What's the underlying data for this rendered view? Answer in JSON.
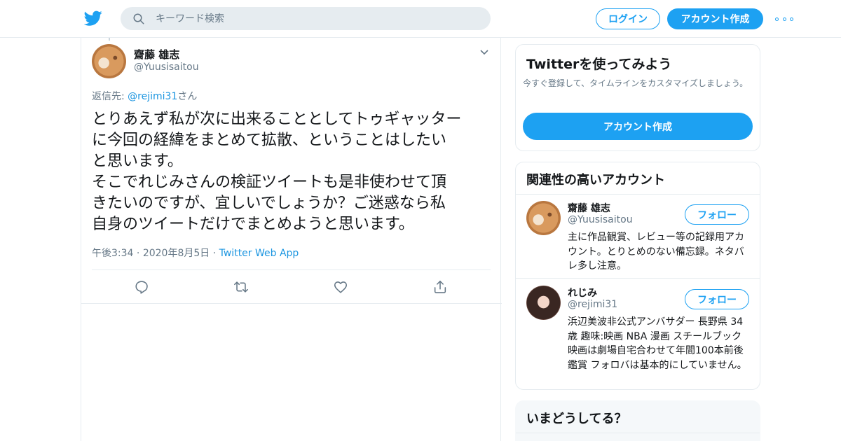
{
  "header": {
    "search_placeholder": "キーワード検索",
    "login_label": "ログイン",
    "signup_label": "アカウント作成",
    "logo_icon": "twitter-bird-icon",
    "more_icon": "more-dots-icon",
    "accent": "#1da1f2"
  },
  "tweet": {
    "author_name": "齋藤 雄志",
    "author_handle": "@Yuusisaitou",
    "reply_prefix": "返信先: ",
    "reply_to": "@rejimi31",
    "reply_suffix": "さん",
    "text": "とりあえず私が次に出来ることとしてトゥギャッター\nに今回の経緯をまとめて拡散、ということはしたい\nと思います。\nそこでれじみさんの検証ツイートも是非使わせて頂\nきたいのですが、宜しいでしょうか？ご迷惑なら私\n自身のツイートだけでまとめようと思います。",
    "time": "午後3:34",
    "date": "2020年8月5日",
    "app": "Twitter Web App",
    "actions": [
      "reply-icon",
      "retweet-icon",
      "like-icon",
      "share-icon"
    ]
  },
  "sidebar": {
    "signup_card": {
      "title": "Twitterを使ってみよう",
      "description": "今すぐ登録して、タイムラインをカスタマイズしましょう。",
      "button": "アカウント作成"
    },
    "related": {
      "title": "関連性の高いアカウント",
      "accounts": [
        {
          "name": "齋藤 雄志",
          "handle": "@Yuusisaitou",
          "follow_label": "フォロー",
          "bio": "主に作品観賞、レビュー等の記録用アカウント。とりとめのない備忘録。ネタバレ多し注意。"
        },
        {
          "name": "れじみ",
          "handle": "@rejimi31",
          "follow_label": "フォロー",
          "bio": "浜辺美波非公式アンバサダー 長野県 34歳 趣味:映画 NBA 漫画 スチールブック 映画は劇場自宅合わせて年間100本前後鑑賞 フォロバは基本的にしていません。"
        }
      ]
    },
    "trends": {
      "title": "いまどうしてる？"
    }
  }
}
